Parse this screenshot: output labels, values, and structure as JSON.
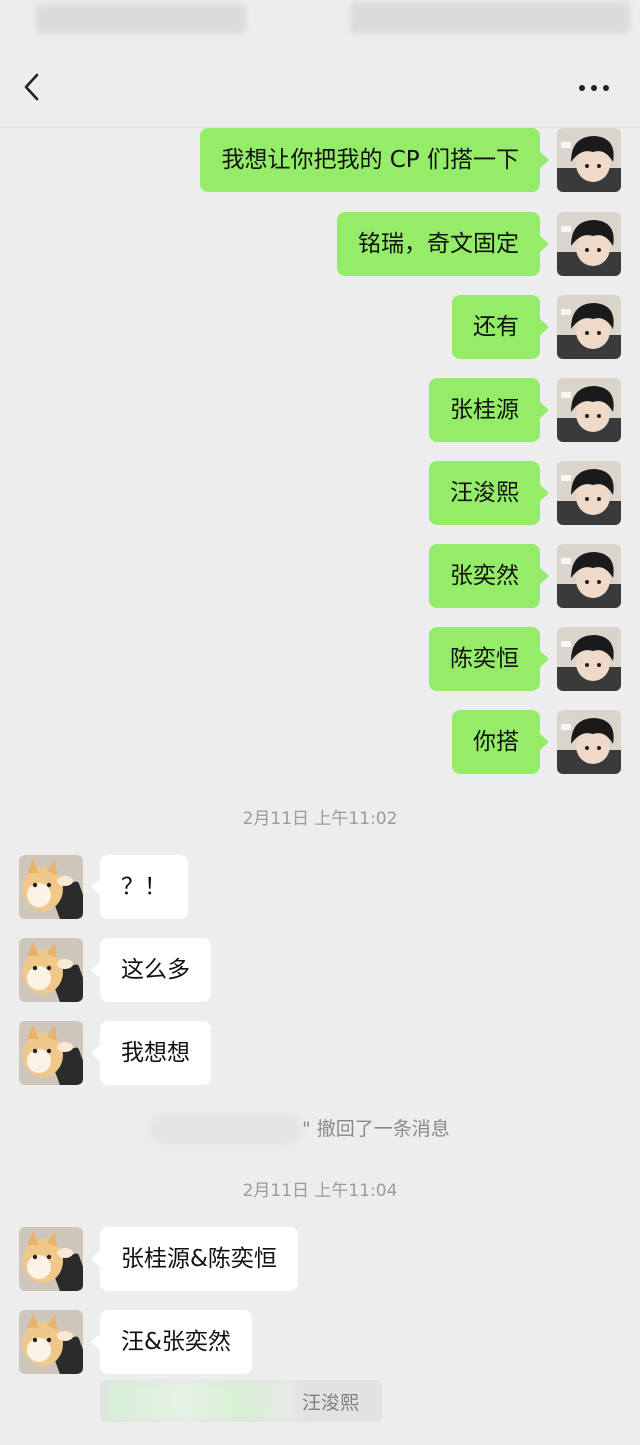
{
  "header": {
    "title": "",
    "back_icon": "back-chevron-icon",
    "more_icon": "more-dots-icon"
  },
  "colors": {
    "background": "#ededed",
    "outgoing_bubble": "#95ec69",
    "incoming_bubble": "#ffffff",
    "timestamp_text": "#9b9b9b"
  },
  "messages_outgoing": [
    {
      "text": "我想让你把我的 CP 们搭一下"
    },
    {
      "text": "铭瑞，奇文固定"
    },
    {
      "text": "还有"
    },
    {
      "text": "张桂源"
    },
    {
      "text": "汪浚熙"
    },
    {
      "text": "张奕然"
    },
    {
      "text": "陈奕恒"
    },
    {
      "text": "你搭"
    }
  ],
  "timestamps": [
    {
      "text": "2月11日 上午11:02"
    },
    {
      "text": "2月11日 上午11:04"
    }
  ],
  "messages_incoming_1": [
    {
      "text": "？！"
    },
    {
      "text": "这么多"
    },
    {
      "text": "我想想"
    }
  ],
  "system": {
    "recall_text": "\" 撤回了一条消息"
  },
  "messages_incoming_2": [
    {
      "text": "张桂源&陈奕恒"
    },
    {
      "text": "汪&张奕然"
    }
  ],
  "quote": {
    "text": "汪浚熙"
  }
}
